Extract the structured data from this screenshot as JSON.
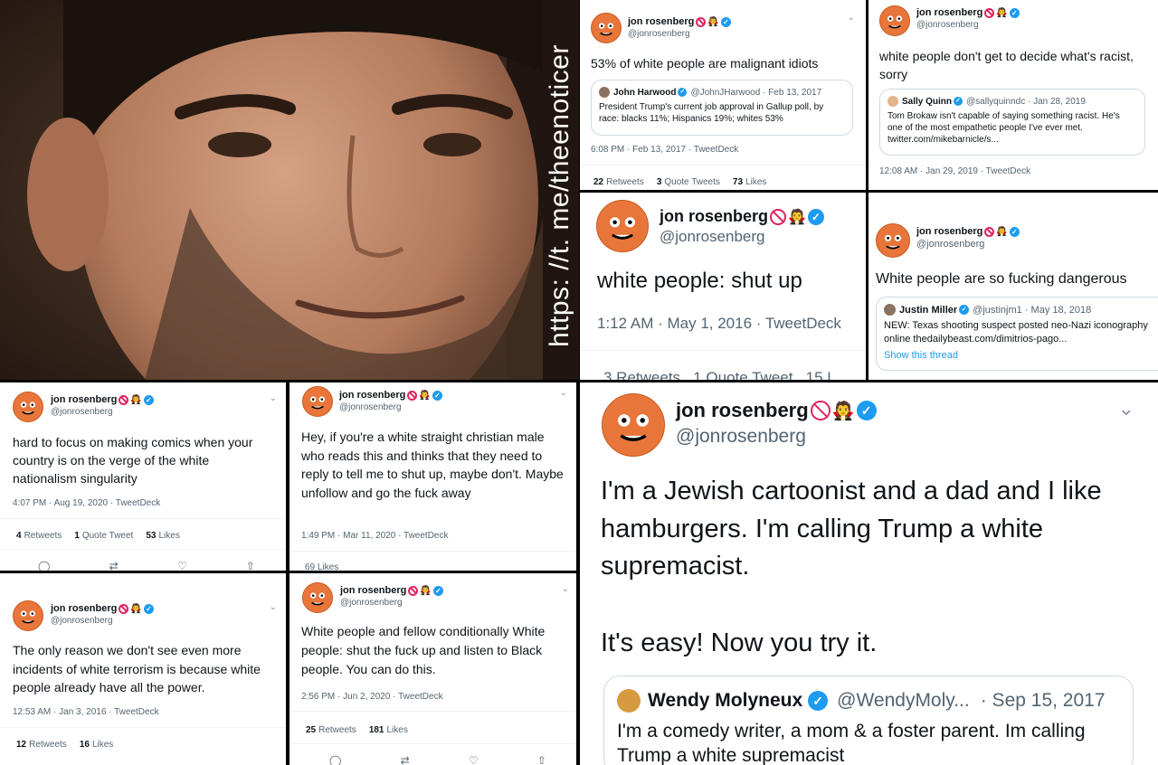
{
  "photo": {
    "watermark": "https: //t. me/theenoticer"
  },
  "tweet1": {
    "name": "jon rosenberg",
    "handle": "@jonrosenberg",
    "text": "53% of white people are malignant idiots",
    "quote": {
      "name": "John Harwood",
      "handle": "@JohnJHarwood · Feb 13, 2017",
      "text": "President Trump's current job approval in Gallup poll, by race: blacks 11%; Hispanics 19%; whites 53%"
    },
    "meta": "6:08 PM · Feb 13, 2017 · TweetDeck",
    "stats": [
      {
        "num": "22",
        "label": "Retweets"
      },
      {
        "num": "3",
        "label": "Quote Tweets"
      },
      {
        "num": "73",
        "label": "Likes"
      }
    ]
  },
  "tweet2": {
    "name": "jon rosenberg",
    "handle": "@jonrosenberg",
    "text": "white people don't get to decide what's racist, sorry",
    "quote": {
      "name": "Sally Quinn",
      "handle": "@sallyquinndc · Jan 28, 2019",
      "text": "Tom Brokaw isn't capable of saying something racist. He's one of the most empathetic people I've ever met. twitter.com/mikebarnicle/s..."
    },
    "meta": "12:08 AM · Jan 29, 2019 · TweetDeck"
  },
  "tweet3": {
    "name": "jon rosenberg",
    "handle": "@jonrosenberg",
    "text": "white people: shut up",
    "meta": "1:12 AM · May 1, 2016 · TweetDeck",
    "stats_partial": "3 Retweets   1 Quote Tweet   15 L"
  },
  "tweet4": {
    "name": "jon rosenberg",
    "handle": "@jonrosenberg",
    "text": "White people are so fucking dangerous",
    "quote": {
      "name": "Justin Miller",
      "handle": "@justinjm1 · May 18, 2018",
      "text": "NEW: Texas shooting suspect posted neo-Nazi iconography online thedailybeast.com/dimitrios-pago...",
      "link": "Show this thread"
    }
  },
  "tweet5": {
    "name": "jon rosenberg",
    "handle": "@jonrosenberg",
    "text": "hard to focus on making comics when your country is on the verge of the white nationalism singularity",
    "meta": "4:07 PM · Aug 19, 2020 · TweetDeck",
    "stats": [
      {
        "num": "4",
        "label": "Retweets"
      },
      {
        "num": "1",
        "label": "Quote Tweet"
      },
      {
        "num": "53",
        "label": "Likes"
      }
    ]
  },
  "tweet6": {
    "name": "jon rosenberg",
    "handle": "@jonrosenberg",
    "text": "Hey, if you're a white straight christian male who reads this and thinks that they need to reply to tell me to shut up, maybe don't. Maybe unfollow and go the fuck away",
    "meta": "1:49 PM · Mar 11, 2020 · TweetDeck",
    "stats_partial": "69 Likes"
  },
  "tweet7": {
    "name": "jon rosenberg",
    "handle": "@jonrosenberg",
    "text": "The only reason we don't see even more incidents of white terrorism is because white people already have all the power.",
    "meta": "12:53 AM · Jan 3, 2016 · TweetDeck",
    "stats": [
      {
        "num": "12",
        "label": "Retweets"
      },
      {
        "num": "16",
        "label": "Likes"
      }
    ]
  },
  "tweet8": {
    "name": "jon rosenberg",
    "handle": "@jonrosenberg",
    "text": "White people and fellow conditionally White people: shut the fuck up and listen to Black people. You can do this.",
    "meta": "2:56 PM · Jun 2, 2020 · TweetDeck",
    "stats": [
      {
        "num": "25",
        "label": "Retweets"
      },
      {
        "num": "181",
        "label": "Likes"
      }
    ]
  },
  "tweet9": {
    "name": "jon rosenberg",
    "handle": "@jonrosenberg",
    "text_p1": "I'm a Jewish cartoonist and a dad and I like hamburgers. I'm calling Trump a white supremacist.",
    "text_p2": "It's easy! Now you try it.",
    "quote": {
      "name": "Wendy Molyneux",
      "handle": "@WendyMoly...",
      "date": "· Sep 15, 2017",
      "text": "I'm a comedy writer, a mom & a foster parent. Im calling Trump a white supremacist"
    }
  },
  "icons": {
    "chevron": "chevron-down-icon",
    "verified": "verified-badge-icon",
    "ban": "no-entry-icon",
    "vampire": "vampire-icon"
  },
  "colors": {
    "accent": "#1d9bf0",
    "avatar": "#e8763a",
    "text": "#0f1419",
    "secondary": "#536471"
  }
}
